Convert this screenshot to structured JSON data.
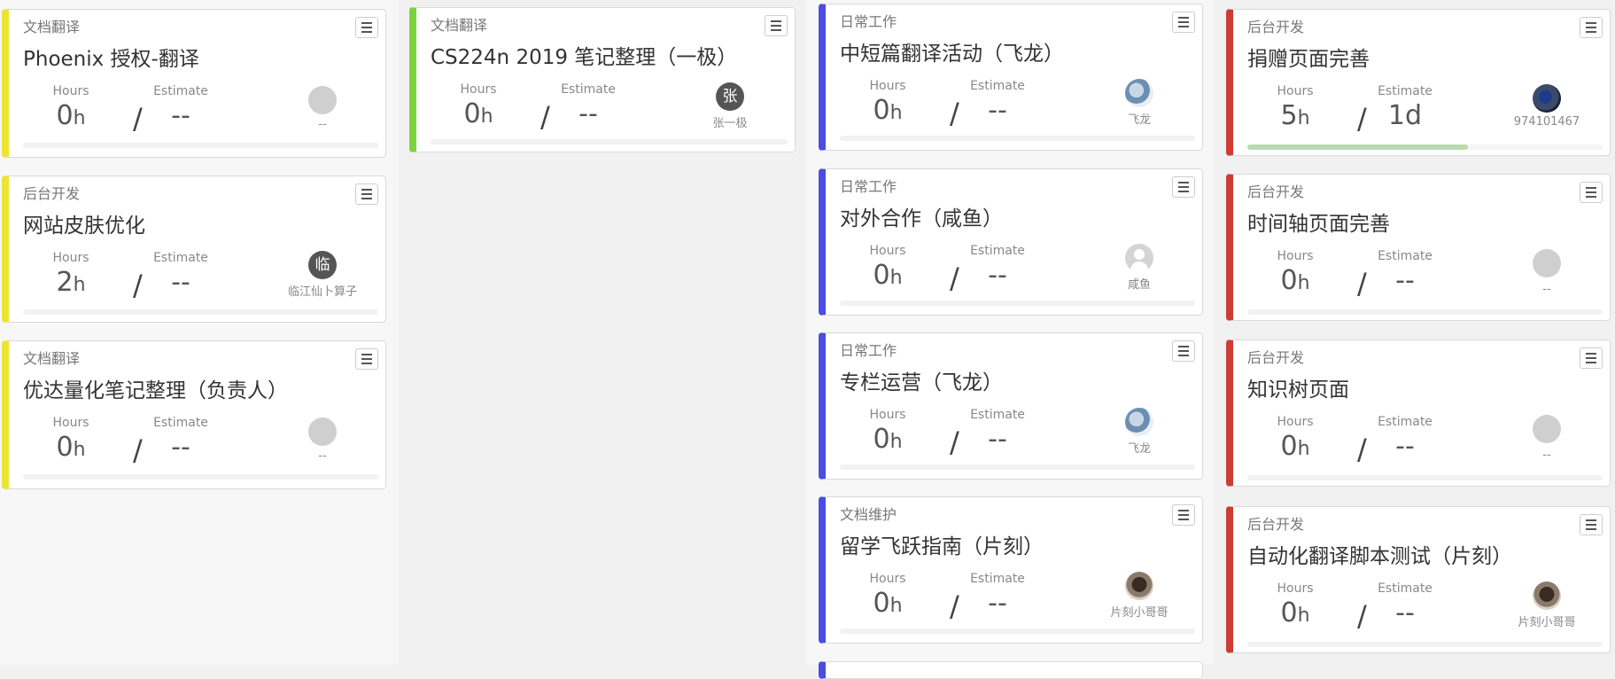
{
  "labels": {
    "hours": "Hours",
    "estimate": "Estimate",
    "slash": "/",
    "hours_unit": "h"
  },
  "colors": {
    "yellow": "#ebe531",
    "green": "#7ed23c",
    "blue": "#4a4de0",
    "red": "#cc3c33"
  },
  "columns": [
    {
      "cards": [
        {
          "category": "文档翻译",
          "title": "Phoenix 授权-翻译",
          "hours": "0",
          "estimate": "--",
          "owner": "--",
          "avatar": "default",
          "avatar_text": "",
          "progress": 0
        },
        {
          "category": "后台开发",
          "title": "网站皮肤优化",
          "hours": "2",
          "estimate": "--",
          "owner": "临江仙卜算子",
          "avatar": "letter",
          "avatar_text": "临",
          "progress": 0
        },
        {
          "category": "文档翻译",
          "title": "优达量化笔记整理（负责人）",
          "hours": "0",
          "estimate": "--",
          "owner": "--",
          "avatar": "default",
          "avatar_text": "",
          "progress": 0
        }
      ]
    },
    {
      "cards": [
        {
          "category": "文档翻译",
          "title": "CS224n 2019 笔记整理（一极）",
          "hours": "0",
          "estimate": "--",
          "owner": "张一极",
          "avatar": "letter",
          "avatar_text": "张",
          "progress": 0
        }
      ]
    },
    {
      "cards": [
        {
          "category": "日常工作",
          "title": "中短篇翻译活动（飞龙）",
          "hours": "0",
          "estimate": "--",
          "owner": "飞龙",
          "avatar": "photo",
          "avatar_text": "",
          "progress": 0
        },
        {
          "category": "日常工作",
          "title": "对外合作（咸鱼）",
          "hours": "0",
          "estimate": "--",
          "owner": "咸鱼",
          "avatar": "person",
          "avatar_text": "",
          "progress": 0
        },
        {
          "category": "日常工作",
          "title": "专栏运营（飞龙）",
          "hours": "0",
          "estimate": "--",
          "owner": "飞龙",
          "avatar": "photo",
          "avatar_text": "",
          "progress": 0
        },
        {
          "category": "文档维护",
          "title": "留学飞跃指南（片刻）",
          "hours": "0",
          "estimate": "--",
          "owner": "片刻小哥哥",
          "avatar": "photo2",
          "avatar_text": "",
          "progress": 0
        }
      ]
    },
    {
      "cards": [
        {
          "category": "后台开发",
          "title": "捐赠页面完善",
          "hours": "5",
          "estimate": "1d",
          "owner": "974101467",
          "avatar": "blue",
          "avatar_text": "",
          "progress": 0.62
        },
        {
          "category": "后台开发",
          "title": "时间轴页面完善",
          "hours": "0",
          "estimate": "--",
          "owner": "--",
          "avatar": "default",
          "avatar_text": "",
          "progress": 0
        },
        {
          "category": "后台开发",
          "title": "知识树页面",
          "hours": "0",
          "estimate": "--",
          "owner": "--",
          "avatar": "default",
          "avatar_text": "",
          "progress": 0
        },
        {
          "category": "后台开发",
          "title": "自动化翻译脚本测试（片刻）",
          "hours": "0",
          "estimate": "--",
          "owner": "片刻小哥哥",
          "avatar": "photo2",
          "avatar_text": "",
          "progress": 0
        }
      ]
    }
  ]
}
